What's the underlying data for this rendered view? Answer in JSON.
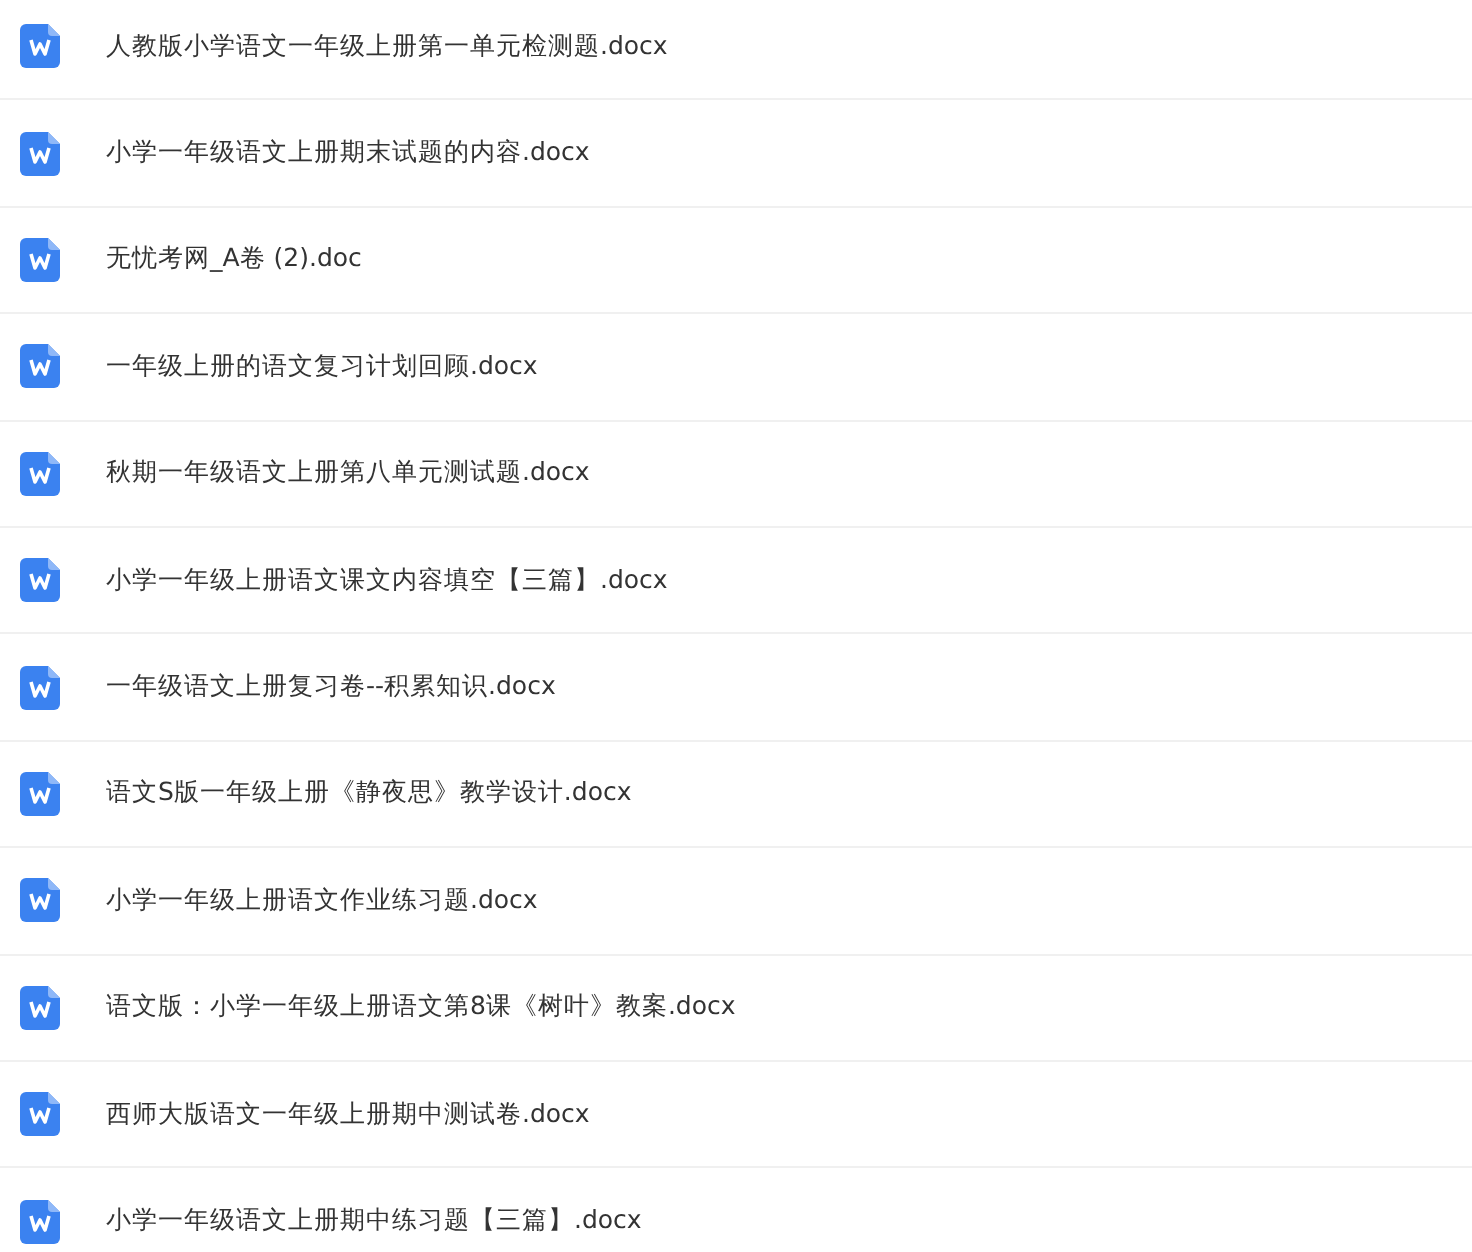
{
  "files": [
    {
      "name": "人教版小学语文一年级上册第一单元检测题.docx"
    },
    {
      "name": "小学一年级语文上册期末试题的内容.docx"
    },
    {
      "name": "无忧考网_A卷 (2).doc"
    },
    {
      "name": "一年级上册的语文复习计划回顾.docx"
    },
    {
      "name": "秋期一年级语文上册第八单元测试题.docx"
    },
    {
      "name": "小学一年级上册语文课文内容填空【三篇】.docx"
    },
    {
      "name": "一年级语文上册复习卷--积累知识.docx"
    },
    {
      "name": "语文S版一年级上册《静夜思》教学设计.docx"
    },
    {
      "name": "小学一年级上册语文作业练习题.docx"
    },
    {
      "name": "语文版：小学一年级上册语文第8课《树叶》教案.docx"
    },
    {
      "name": "西师大版语文一年级上册期中测试卷.docx"
    },
    {
      "name": "小学一年级语文上册期中练习题【三篇】.docx"
    }
  ]
}
